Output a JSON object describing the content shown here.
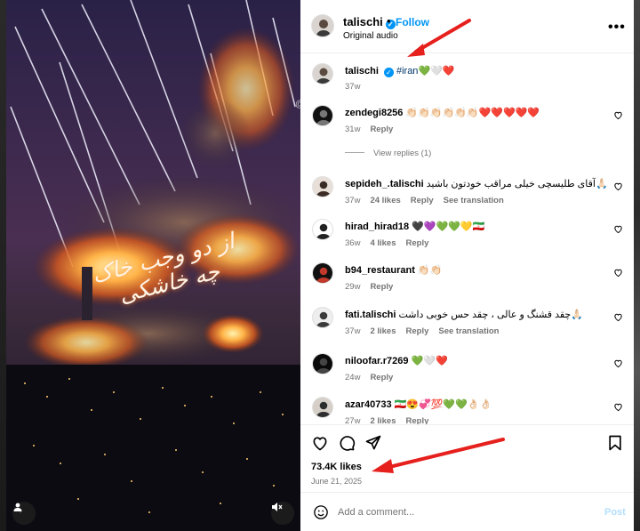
{
  "post": {
    "author": "talischi",
    "follow_label": "Follow",
    "dot": "•",
    "audio": "Original audio",
    "more": "•••"
  },
  "media": {
    "caption": "از دو وجب خاک چه خاشکی",
    "at_sign": "@"
  },
  "caption_comment": {
    "user": "talischi",
    "hashtag": "#iran",
    "emoji": "💚🤍❤️",
    "time": "37w"
  },
  "comments": [
    {
      "user": "zendegi8256",
      "text": "👏🏻👏🏻👏🏻👏🏻👏🏻👏🏻❤️❤️❤️❤️❤️",
      "time": "31w",
      "likes": "",
      "reply": "Reply",
      "translate": "",
      "view_replies": "View replies (1)"
    },
    {
      "user": "sepideh_.talischi",
      "text": "آقای طلیسچی خیلی مراقب خودتون باشید🙏🏻",
      "time": "37w",
      "likes": "24 likes",
      "reply": "Reply",
      "translate": "See translation",
      "view_replies": ""
    },
    {
      "user": "hirad_hirad18",
      "text": "🖤💜💚💚💛🇮🇷",
      "time": "36w",
      "likes": "4 likes",
      "reply": "Reply",
      "translate": "",
      "view_replies": ""
    },
    {
      "user": "b94_restaurant",
      "text": "👏🏻👏🏻",
      "time": "29w",
      "likes": "",
      "reply": "Reply",
      "translate": "",
      "view_replies": ""
    },
    {
      "user": "fati.talischi",
      "text": "چقد قشنگ و عالی ، چقد حس خوبی داشت🙏🏻",
      "time": "37w",
      "likes": "2 likes",
      "reply": "Reply",
      "translate": "See translation",
      "view_replies": ""
    },
    {
      "user": "niloofar.r7269",
      "text": "💚🤍❤️",
      "time": "24w",
      "likes": "",
      "reply": "Reply",
      "translate": "",
      "view_replies": ""
    },
    {
      "user": "azar40733",
      "text": "🇮🇷😍💞💯💚💚👌🏻👌🏻",
      "time": "27w",
      "likes": "2 likes",
      "reply": "Reply",
      "translate": "",
      "view_replies": ""
    }
  ],
  "footer": {
    "likes": "73.4K likes",
    "date": "June 21, 2025",
    "add_comment_placeholder": "Add a comment...",
    "post_label": "Post"
  },
  "colors": {
    "link_blue": "#0095f6",
    "annotation_red": "#e5201d"
  }
}
